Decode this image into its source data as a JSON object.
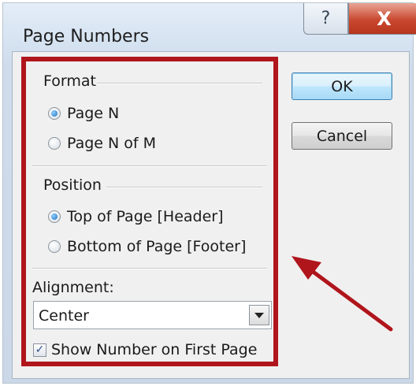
{
  "window": {
    "title": "Page Numbers",
    "help_glyph": "?",
    "close_glyph": "X"
  },
  "format": {
    "label": "Format",
    "options": [
      "Page N",
      "Page N of M"
    ],
    "selected": "Page N"
  },
  "position": {
    "label": "Position",
    "options": [
      "Top of Page [Header]",
      "Bottom of Page [Footer]"
    ],
    "selected": "Top of Page [Header]"
  },
  "alignment": {
    "label": "Alignment:",
    "value": "Center"
  },
  "show_first_page": {
    "label": "Show Number on First Page",
    "checked": true
  },
  "buttons": {
    "ok": "OK",
    "cancel": "Cancel"
  },
  "annotation": {
    "highlight_color": "#b0151c",
    "arrow_color": "#b0151c"
  }
}
